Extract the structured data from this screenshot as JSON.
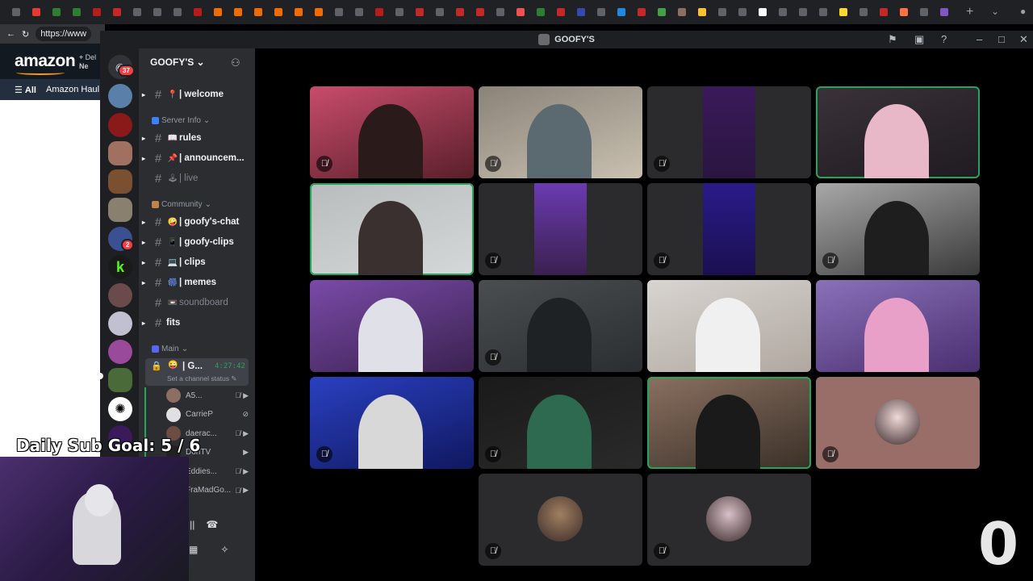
{
  "browser": {
    "url_text": "https://www",
    "tab_favicon_colors": [
      "#5f6368",
      "#e53935",
      "#2e7d32",
      "#2e7d32",
      "#b71c1c",
      "#c62828",
      "#5f6368",
      "#5f6368",
      "#5f6368",
      "#b71c1c",
      "#ef6c00",
      "#ef6c00",
      "#ef6c00",
      "#ef6c00",
      "#ef6c00",
      "#ef6c00",
      "#5f6368",
      "#5f6368",
      "#b71c1c",
      "#5f6368",
      "#c62828",
      "#5f6368",
      "#c62828",
      "#c62828",
      "#5f6368",
      "#ef5350",
      "#2e7d32",
      "#c62828",
      "#3949ab",
      "#5f6368",
      "#1e88e5",
      "#c62828",
      "#43a047",
      "#8d6e63",
      "#fbc02d",
      "#5f6368",
      "#5f6368",
      "#fff",
      "#5f6368",
      "#5f6368",
      "#5f6368",
      "#fdd835",
      "#5f6368",
      "#c62828",
      "#ff7043",
      "#5f6368",
      "#7e57c2"
    ]
  },
  "amazon": {
    "logo": "amazon",
    "deliver_line1": "Del",
    "deliver_line2": "Ne",
    "nav_all": "All",
    "nav_haul": "Amazon Haul"
  },
  "discord": {
    "window_title": "GOOFY'S",
    "home_badge": "37",
    "server_badge": "2",
    "server_name": "GOOFY'S",
    "channels": {
      "welcome": "| welcome",
      "rules": "rules",
      "announcements": "| announcem...",
      "live": "| live",
      "goofys_chat": "| goofy's-chat",
      "goofy_clips": "| goofy-clips",
      "clips": "| clips",
      "memes": "| memes",
      "soundboard": "soundboard",
      "fits": "fits"
    },
    "categories": {
      "server_info": "Server Info",
      "community": "Community",
      "main": "Main"
    },
    "voice": {
      "channel_name": "| G...",
      "elapsed": "4:27:42",
      "status_placeholder": "Set a channel status",
      "users": [
        "A5...",
        "CarrieP",
        "daerac...",
        "DonTV",
        "Eddies...",
        "FraMadGo..."
      ],
      "user_avatar_colors": [
        "#8d6e63",
        "#e0e0e0",
        "#6d4c41",
        "#212121",
        "#455a64",
        "#3e2723"
      ]
    },
    "tiles": [
      {
        "muted": true,
        "speaking": false,
        "bg": "#c84c6c",
        "bg2": "#5a1f2a",
        "kind": "video",
        "person": "#2a1a1a"
      },
      {
        "muted": true,
        "speaking": false,
        "bg": "#8a8378",
        "bg2": "#c9c0b0",
        "kind": "video",
        "person": "#5a6a70"
      },
      {
        "muted": true,
        "speaking": false,
        "bg": "#2b2b2e",
        "bg2": "#3a1a5a",
        "kind": "narrow",
        "person": "#2a1540"
      },
      {
        "muted": false,
        "speaking": true,
        "bg": "#3a3238",
        "bg2": "#1f1b20",
        "kind": "video",
        "person": "#e8b8c8"
      },
      {
        "muted": false,
        "speaking": true,
        "bg": "#b8bcbd",
        "bg2": "#d5d8d8",
        "kind": "video",
        "person": "#3a3030"
      },
      {
        "muted": true,
        "speaking": false,
        "bg": "#2b2b2e",
        "bg2": "#6a3bb0",
        "kind": "narrow",
        "person": "#3a2050"
      },
      {
        "muted": true,
        "speaking": false,
        "bg": "#2b2b2e",
        "bg2": "#2a1a8a",
        "kind": "narrow",
        "person": "#1a1050"
      },
      {
        "muted": true,
        "speaking": false,
        "bg": "#a8a8a8",
        "bg2": "#3a3a3a",
        "kind": "video",
        "person": "#1e1e1e"
      },
      {
        "muted": false,
        "speaking": false,
        "bg": "#7a4aa8",
        "bg2": "#3a2250",
        "kind": "video",
        "person": "#e0e0e8"
      },
      {
        "muted": true,
        "speaking": false,
        "bg": "#4a4e50",
        "bg2": "#2a2e30",
        "kind": "video",
        "person": "#1e2224"
      },
      {
        "muted": false,
        "speaking": false,
        "bg": "#d8d4d0",
        "bg2": "#b0a8a0",
        "kind": "video",
        "person": "#f0f0f0"
      },
      {
        "muted": false,
        "speaking": false,
        "bg": "#8a70b8",
        "bg2": "#4a3070",
        "kind": "video",
        "person": "#e8a0c8"
      },
      {
        "muted": true,
        "speaking": false,
        "bg": "#2a40c0",
        "bg2": "#101860",
        "kind": "video",
        "person": "#d8d8d8"
      },
      {
        "muted": true,
        "speaking": false,
        "bg": "#1a1a1a",
        "bg2": "#2a2a2a",
        "kind": "video",
        "person": "#2e6a50"
      },
      {
        "muted": false,
        "speaking": true,
        "bg": "#8a7060",
        "bg2": "#3a3028",
        "kind": "video",
        "person": "#1a1a1a"
      },
      {
        "muted": true,
        "speaking": false,
        "bg": "#9a6e68",
        "bg2": "#9a6e68",
        "kind": "avatar",
        "person": "#f0d8d8"
      },
      {
        "muted": true,
        "speaking": false,
        "bg": "#2b2b2e",
        "bg2": "#2b2b2e",
        "kind": "avatar",
        "person": "#a08060"
      },
      {
        "muted": true,
        "speaking": false,
        "bg": "#2b2b2e",
        "bg2": "#2b2b2e",
        "kind": "avatar",
        "person": "#d8c0c8"
      }
    ]
  },
  "overlay": {
    "sub_goal": "Daily Sub Goal:  5 / 6",
    "counter": "0"
  }
}
